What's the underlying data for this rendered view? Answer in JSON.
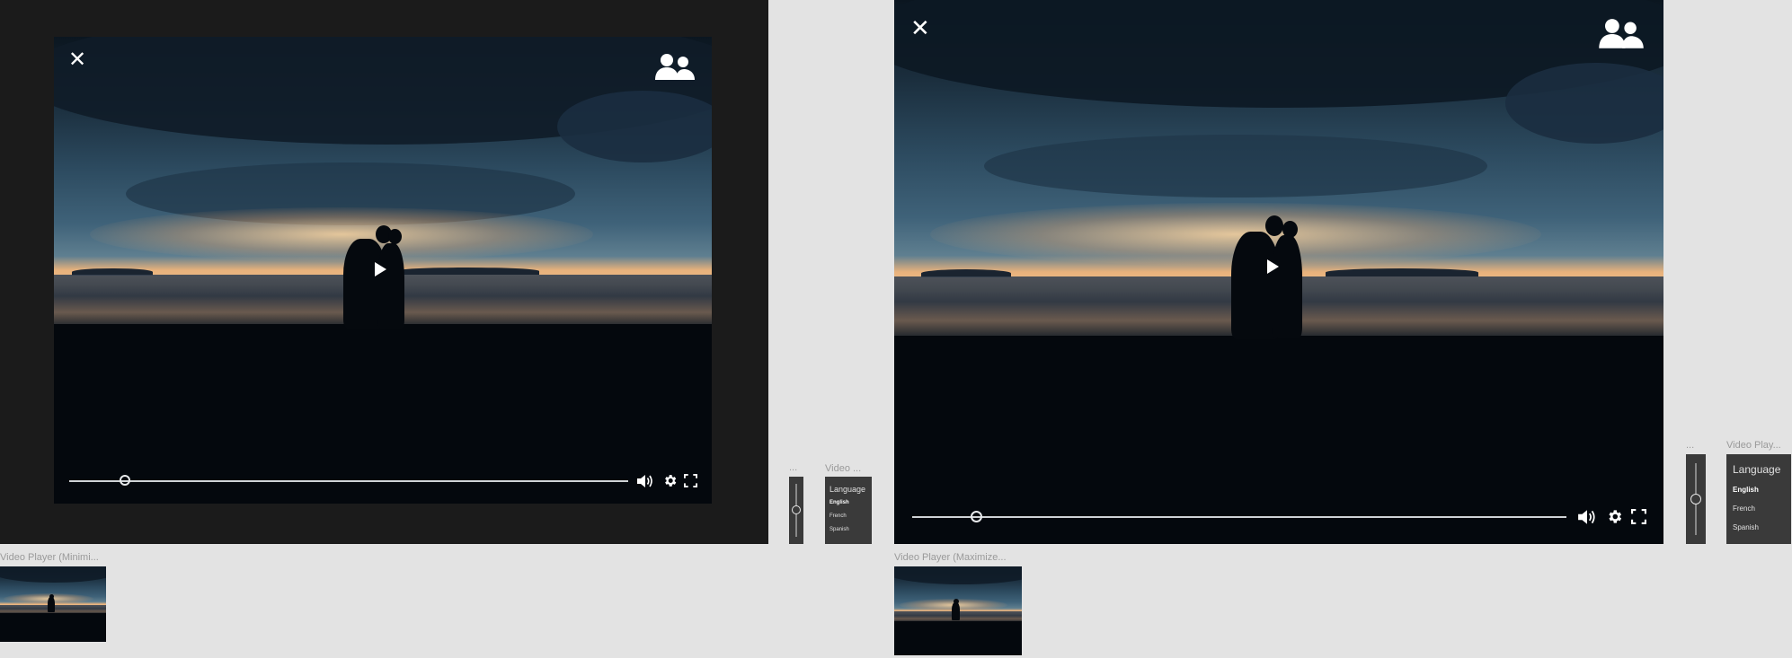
{
  "frames": {
    "minimized_caption": "Video Player (Minimi...",
    "maximized_caption": "Video Player (Maximize..."
  },
  "side": {
    "volume_caption_small": "...",
    "volume_caption_large": "...",
    "language_caption_small": "Video ...",
    "language_caption_large": "Video Play..."
  },
  "language_menu": {
    "title": "Language",
    "options": [
      "English",
      "French",
      "Spanish"
    ],
    "selected": "English"
  },
  "player": {
    "progress_fraction": 0.1,
    "volume_level": 0.5
  },
  "icons": {
    "close": "close-icon",
    "participants": "people-icon",
    "play": "play-icon",
    "volume": "volume-icon",
    "settings": "gear-icon",
    "fullscreen": "fullscreen-icon"
  },
  "colors": {
    "frame_dark": "#1b1b1b",
    "panel": "#3a3a3a",
    "canvas": "#e3e3e3"
  }
}
